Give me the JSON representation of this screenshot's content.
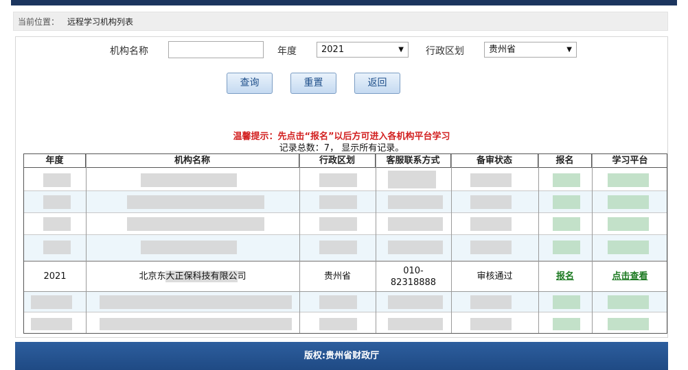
{
  "breadcrumb": {
    "prefix": "当前位置：",
    "current": "远程学习机构列表"
  },
  "search": {
    "org_name_label": "机构名称",
    "org_name_value": "",
    "year_label": "年度",
    "year_value": "2021",
    "region_label": "行政区划",
    "region_value": "贵州省"
  },
  "buttons": {
    "query": "查询",
    "reset": "重置",
    "back": "返回"
  },
  "tip": "温馨提示：先点击“报名”以后方可进入各机构平台学习",
  "record_count": "记录总数：7，  显示所有记录。",
  "table": {
    "headers": [
      "年度",
      "机构名称",
      "行政区划",
      "客服联系方式",
      "备审状态",
      "报名",
      "学习平台"
    ],
    "visible_row": {
      "year": "2021",
      "org_prefix": "北京东",
      "org_highlight": "大正保科技有限公",
      "org_suffix": "司",
      "region": "贵州省",
      "contact_line1": "010-",
      "contact_line2": "82318888",
      "status": "审核通过",
      "enroll": "报名",
      "platform": "点击查看"
    }
  },
  "footer": "版权:贵州省财政厅",
  "colors": {
    "header_bar": "#1b355e",
    "footer_bar": "#2d5e9e",
    "tip_red": "#d21f1f",
    "link_green": "#1d7a22"
  }
}
